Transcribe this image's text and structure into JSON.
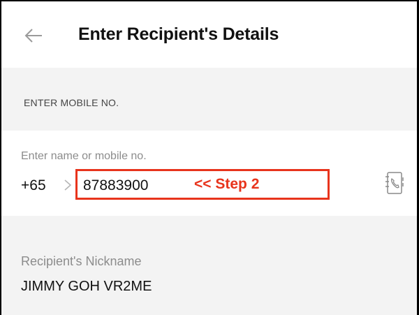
{
  "header": {
    "title": "Enter Recipient's Details",
    "back_icon": "arrow-left-icon"
  },
  "mobile_section": {
    "label": "ENTER MOBILE NO.",
    "input": {
      "placeholder": "Enter name or mobile no.",
      "country_code": "+65",
      "value": "87883900",
      "contacts_icon": "contacts-book-icon"
    },
    "annotation": "<< Step 2"
  },
  "nickname_section": {
    "label": "Recipient's Nickname",
    "value": "JIMMY GOH VR2ME"
  },
  "colors": {
    "annotation_red": "#e8341c",
    "band_gray": "#f3f3f3",
    "muted_text": "#8c8c8c"
  }
}
